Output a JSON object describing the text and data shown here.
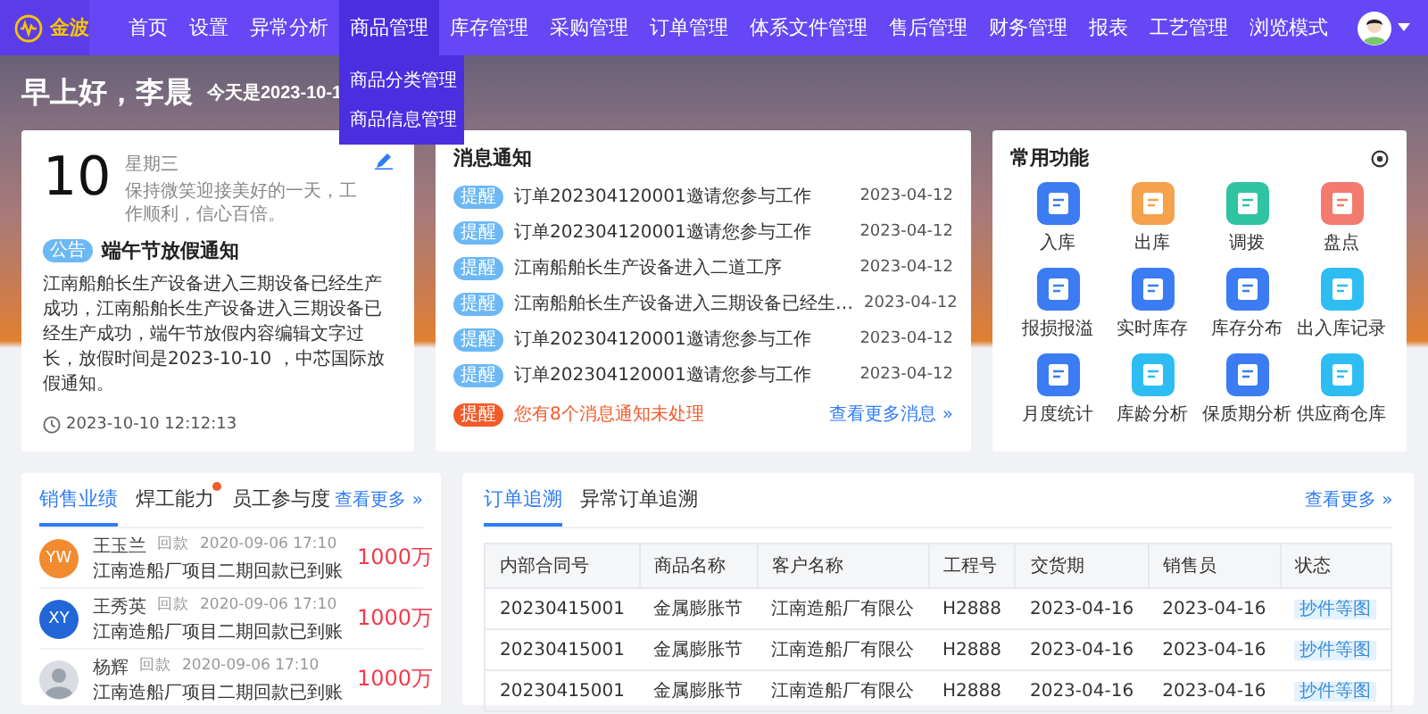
{
  "nav": {
    "logo_text": "金波",
    "items": [
      {
        "label": "首页",
        "selected": false
      },
      {
        "label": "设置",
        "selected": false
      },
      {
        "label": "异常分析",
        "selected": false
      },
      {
        "label": "商品管理",
        "selected": true,
        "dropdown": [
          "商品分类管理",
          "商品信息管理"
        ]
      },
      {
        "label": "库存管理",
        "selected": false
      },
      {
        "label": "采购管理",
        "selected": false
      },
      {
        "label": "订单管理",
        "selected": false
      },
      {
        "label": "体系文件管理",
        "selected": false
      },
      {
        "label": "售后管理",
        "selected": false
      },
      {
        "label": "财务管理",
        "selected": false
      },
      {
        "label": "报表",
        "selected": false
      },
      {
        "label": "工艺管理",
        "selected": false
      },
      {
        "label": "浏览模式",
        "selected": false
      }
    ]
  },
  "greeting": {
    "title": "早上好，李晨",
    "date_text": "今天是2023-10-1"
  },
  "today_card": {
    "day": "10",
    "weekday": "星期三",
    "motto": "保持微笑迎接美好的一天，工作顺利，信心百倍。",
    "notice": {
      "badge": "公告",
      "title": "端午节放假通知",
      "body": "江南船舶长生产设备进入三期设备已经生产成功，江南船舶长生产设备进入三期设备已经生产成功，端午节放假内容编辑文字过长，放假时间是2023-10-10 ，中芯国际放假通知。"
    },
    "timestamp": "2023-10-10 12:12:13"
  },
  "messages": {
    "title": "消息通知",
    "items": [
      {
        "badge": "提醒",
        "text": "订单202304120001邀请您参与工作",
        "date": "2023-04-12"
      },
      {
        "badge": "提醒",
        "text": "订单202304120001邀请您参与工作",
        "date": "2023-04-12"
      },
      {
        "badge": "提醒",
        "text": "江南船舶长生产设备进入二道工序",
        "date": "2023-04-12"
      },
      {
        "badge": "提醒",
        "text": "江南船舶长生产设备进入三期设备已经生…",
        "date": "2023-04-12"
      },
      {
        "badge": "提醒",
        "text": "订单202304120001邀请您参与工作",
        "date": "2023-04-12"
      },
      {
        "badge": "提醒",
        "text": "订单202304120001邀请您参与工作",
        "date": "2023-04-12"
      }
    ],
    "footer": {
      "badge": "提醒",
      "text": "您有8个消息通知未处理",
      "link": "查看更多消息 »"
    }
  },
  "functions": {
    "title": "常用功能",
    "items": [
      {
        "label": "入库",
        "color": "#3b7cf2"
      },
      {
        "label": "出库",
        "color": "#f5a24c"
      },
      {
        "label": "调拨",
        "color": "#2fc4a2"
      },
      {
        "label": "盘点",
        "color": "#f27b6d"
      },
      {
        "label": "报损报溢",
        "color": "#3b7cf2"
      },
      {
        "label": "实时库存",
        "color": "#3b7cf2"
      },
      {
        "label": "库存分布",
        "color": "#3b7cf2"
      },
      {
        "label": "出入库记录",
        "color": "#2dbdf2"
      },
      {
        "label": "月度统计",
        "color": "#3b7cf2"
      },
      {
        "label": "库龄分析",
        "color": "#2dbdf2"
      },
      {
        "label": "保质期分析",
        "color": "#3b7cf2"
      },
      {
        "label": "供应商仓库",
        "color": "#2dbdf2"
      }
    ]
  },
  "sales": {
    "tabs": [
      {
        "label": "销售业绩",
        "selected": true,
        "dot": false
      },
      {
        "label": "焊工能力",
        "selected": false,
        "dot": true
      },
      {
        "label": "员工参与度",
        "selected": false,
        "dot": false
      }
    ],
    "more": "查看更多 »",
    "rows": [
      {
        "avatar": {
          "kind": "initials",
          "text": "YW",
          "color": "#f28a30"
        },
        "name": "王玉兰",
        "type": "回款",
        "time": "2020-09-06  17:10",
        "desc": "江南造船厂项目二期回款已到账",
        "amount": "1000万"
      },
      {
        "avatar": {
          "kind": "initials",
          "text": "XY",
          "color": "#2266d8"
        },
        "name": "王秀英",
        "type": "回款",
        "time": "2020-09-06  17:10",
        "desc": "江南造船厂项目二期回款已到账",
        "amount": "1000万"
      },
      {
        "avatar": {
          "kind": "photo"
        },
        "name": "杨辉",
        "type": "回款",
        "time": "2020-09-06  17:10",
        "desc": "江南造船厂项目二期回款已到账",
        "amount": "1000万"
      }
    ]
  },
  "orders": {
    "tabs": [
      {
        "label": "订单追溯",
        "selected": true
      },
      {
        "label": "异常订单追溯",
        "selected": false
      }
    ],
    "more": "查看更多 »",
    "table": {
      "columns": [
        "内部合同号",
        "商品名称",
        "客户名称",
        "工程号",
        "交货期",
        "销售员",
        "状态"
      ],
      "rows": [
        [
          "20230415001",
          "金属膨胀节",
          "江南造船厂有限公",
          "H2888",
          "2023-04-16",
          "2023-04-16",
          "抄件等图"
        ],
        [
          "20230415001",
          "金属膨胀节",
          "江南造船厂有限公",
          "H2888",
          "2023-04-16",
          "2023-04-16",
          "抄件等图"
        ],
        [
          "20230415001",
          "金属膨胀节",
          "江南造船厂有限公",
          "H2888",
          "2023-04-16",
          "2023-04-16",
          "抄件等图"
        ]
      ]
    }
  }
}
